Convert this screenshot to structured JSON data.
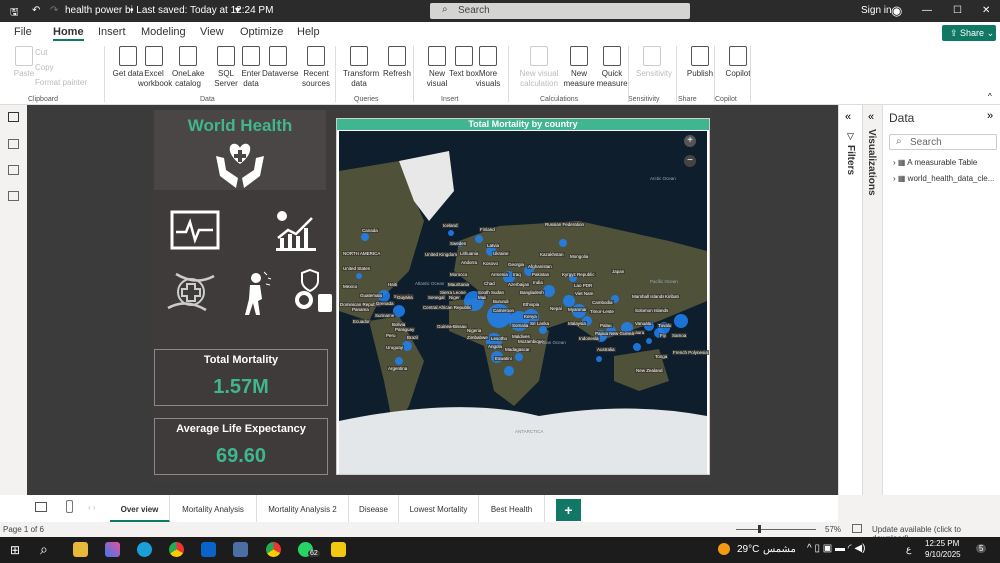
{
  "titlebar": {
    "title": "health power bi",
    "saved": "• Last saved: Today at 12:24 PM",
    "search_placeholder": "Search",
    "sign_in": "Sign in"
  },
  "menu": [
    "File",
    "Home",
    "Insert",
    "Modeling",
    "View",
    "Optimize",
    "Help"
  ],
  "share_label": "Share",
  "ribbon": {
    "clipboard": [
      "Paste",
      "Cut",
      "Copy",
      "Format painter"
    ],
    "data": [
      "Get data",
      "Excel workbook",
      "OneLake catalog",
      "SQL Server",
      "Enter data",
      "Dataverse",
      "Recent sources"
    ],
    "queries": [
      "Transform data",
      "Refresh"
    ],
    "insert": [
      "New visual",
      "Text box",
      "More visuals"
    ],
    "calculations": [
      "New visual calculation",
      "New measure",
      "Quick measure"
    ],
    "sensitivity": [
      "Sensitivity"
    ],
    "share": [
      "Publish"
    ],
    "copilot": [
      "Copilot"
    ],
    "groups": [
      "Clipboard",
      "Data",
      "Queries",
      "Insert",
      "Calculations",
      "Sensitivity",
      "Share",
      "Copilot"
    ]
  },
  "report": {
    "title": "World Health",
    "kpis": [
      {
        "label": "Total Mortality",
        "value": "1.57M"
      },
      {
        "label": "Average Life Expectancy",
        "value": "69.60"
      }
    ],
    "map": {
      "title": "Total Mortality by country",
      "labels": [
        "Canada",
        "Iceland",
        "Finland",
        "Russian Federation",
        "Sweden",
        "Latvia",
        "NORTH AMERICA",
        "United Kingdom",
        "Lithuania",
        "Ukraine",
        "Kazakhstan",
        "Mongolia",
        "Andorra",
        "Kosovo",
        "Georgia",
        "Afghanistan",
        "United States",
        "Morocco",
        "Armenia",
        "Iraq",
        "Pakistan",
        "Kyrgyz Republic",
        "Japan",
        "Mexico",
        "Haiti",
        "Atlantic Ocean",
        "Mauritania",
        "Chad",
        "Azerbaijan",
        "India",
        "Lao PDR",
        "Pacific Ocean",
        "Arctic Ocean",
        "Guatemala",
        "St. Lucia",
        "Sierra Leone",
        "South Sudan",
        "Bangladesh",
        "Viet Nam",
        "Dominican Republic",
        "Grenada",
        "Guyana",
        "Senegal",
        "Niger",
        "Mali",
        "Burundi",
        "Ethiopia",
        "Nepal",
        "Myanmar",
        "Cambodia",
        "Marshall Islands",
        "Kiribati",
        "Panama",
        "Suriname",
        "Central African Republic",
        "Cameroon",
        "Kenya",
        "Timor-Leste",
        "Solomon Islands",
        "Ecuador",
        "Bolivia",
        "Guinea-Bissau",
        "Nigeria",
        "Somalia",
        "Sri Lanka",
        "Malaysia",
        "Palau",
        "Vanuatu",
        "Tuvalu",
        "Paraguay",
        "Peru",
        "Brazil",
        "Zimbabwe",
        "Lesotho",
        "Maldives",
        "Mozambique",
        "Indian Ocean",
        "Indonesia",
        "Nauru",
        "Samoa",
        "Papua New Guinea",
        "Fiji",
        "Uruguay",
        "Angola",
        "Madagascar",
        "French Polynesia",
        "Tonga",
        "Australia",
        "Eswatini",
        "Argentina",
        "New Zealand",
        "ANTARCTICA"
      ]
    }
  },
  "data_pane": {
    "filters": "Filters",
    "visualizations": "Visualizations",
    "title": "Data",
    "search_placeholder": "Search",
    "tables": [
      "A measurable Table",
      "world_health_data_cle..."
    ]
  },
  "tabs": [
    "Over view",
    "Mortality Analysis",
    "Mortality Analysis 2",
    "Disease",
    "Lowest Mortality",
    "Best Health"
  ],
  "status": {
    "page": "Page 1 of 6",
    "zoom": "57%",
    "update": "Update available (click to download)"
  },
  "taskbar": {
    "weather": "29°C",
    "weather_text": "مشمس",
    "lang": "ع",
    "time": "12:25 PM",
    "date": "9/10/2025",
    "whatsapp_badge": "62",
    "notif": "5"
  }
}
